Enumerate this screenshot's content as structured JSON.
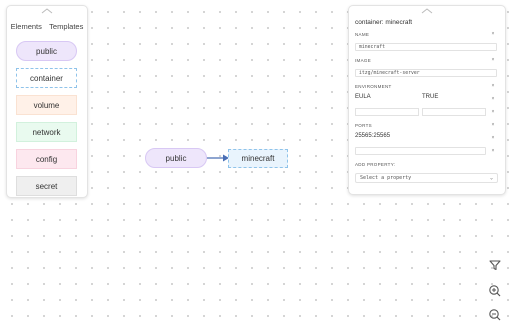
{
  "palette": {
    "tabs": [
      "Elements",
      "Templates"
    ],
    "items": [
      "public",
      "container",
      "volume",
      "network",
      "config",
      "secret"
    ]
  },
  "canvas": {
    "nodes": {
      "public": "public",
      "container": "minecraft"
    }
  },
  "properties": {
    "title": "container: minecraft",
    "name_label": "NAME",
    "name_value": "minecraft",
    "image_label": "IMAGE",
    "image_value": "itzg/minecraft-server",
    "env_label": "ENVIRONMENT",
    "env_key": "EULA",
    "env_value": "TRUE",
    "ports_label": "PORTS",
    "port_value": "25565:25565",
    "add_property_label": "ADD PROPERTY:",
    "select_placeholder": "Select a property",
    "remove_glyph": "×"
  },
  "icons": {
    "collapse": "chevron-up-icon",
    "filter": "filter-icon",
    "zoom_in": "zoom-in-icon",
    "zoom_out": "zoom-out-icon"
  },
  "colors": {
    "public_fill": "#eee6fb",
    "container_border": "#8fc3ea",
    "volume_fill": "#fff1e8",
    "network_fill": "#e9faef",
    "config_fill": "#fde8ef",
    "secret_fill": "#efefef",
    "edge": "#4a6fb5"
  }
}
